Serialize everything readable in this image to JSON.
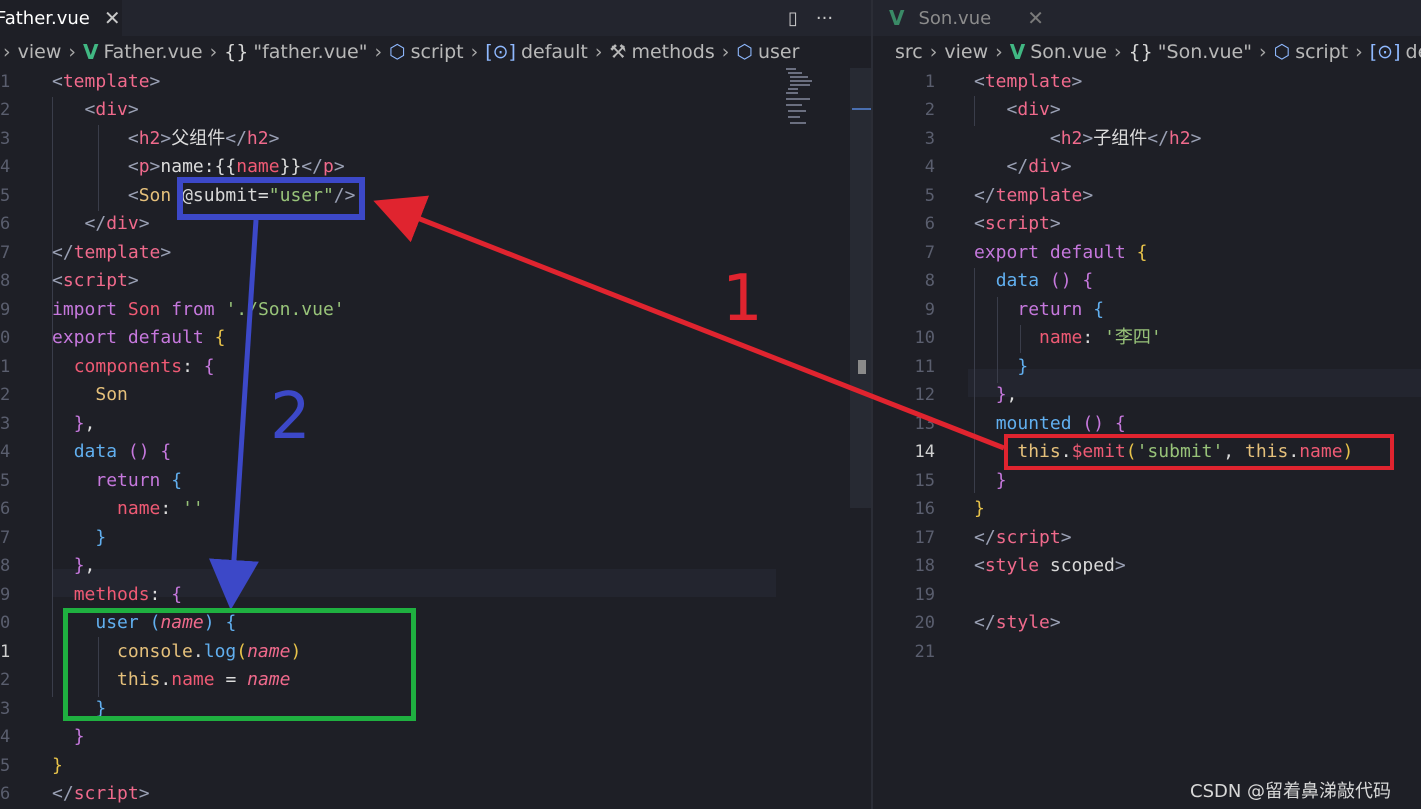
{
  "left_pane": {
    "tab": {
      "label": "Father.vue",
      "close": "✕",
      "active": true
    },
    "tab_icons": [
      "split-editor-icon",
      "more-actions-icon"
    ],
    "breadcrumb": [
      {
        "icon": "",
        "label": "view"
      },
      {
        "icon": "vue-icon",
        "label": "Father.vue"
      },
      {
        "icon": "braces-icon",
        "label": "\"father.vue\""
      },
      {
        "icon": "cube-icon",
        "label": "script"
      },
      {
        "icon": "module-icon",
        "label": "default"
      },
      {
        "icon": "wrench-icon",
        "label": "methods"
      },
      {
        "icon": "cube-icon",
        "label": "user"
      }
    ],
    "line_numbers": [
      "1",
      "2",
      "3",
      "4",
      "5",
      "6",
      "7",
      "8",
      "9",
      "0",
      "1",
      "2",
      "3",
      "4",
      "5",
      "6",
      "7",
      "8",
      "9",
      "0",
      "1",
      "2",
      "3",
      "4",
      "5",
      "6"
    ],
    "active_line_index": 20
  },
  "right_pane": {
    "tab": {
      "label": "Son.vue",
      "close": "✕",
      "active": false
    },
    "breadcrumb": [
      {
        "icon": "",
        "label": "src"
      },
      {
        "icon": "",
        "label": "view"
      },
      {
        "icon": "vue-icon",
        "label": "Son.vue"
      },
      {
        "icon": "braces-icon",
        "label": "\"Son.vue\""
      },
      {
        "icon": "cube-icon",
        "label": "script"
      },
      {
        "icon": "module-icon",
        "label": "def"
      }
    ],
    "line_numbers": [
      "1",
      "2",
      "3",
      "4",
      "5",
      "6",
      "7",
      "8",
      "9",
      "10",
      "11",
      "12",
      "13",
      "14",
      "15",
      "16",
      "17",
      "18",
      "19",
      "20",
      "21"
    ],
    "active_line_number": "14"
  },
  "annotations": {
    "label_1": "1",
    "label_2": "2",
    "colors": {
      "red": "#e0242f",
      "blue": "#3c48c8",
      "green": "#1fb040"
    }
  },
  "watermark": "CSDN @留着鼻涕敲代码"
}
